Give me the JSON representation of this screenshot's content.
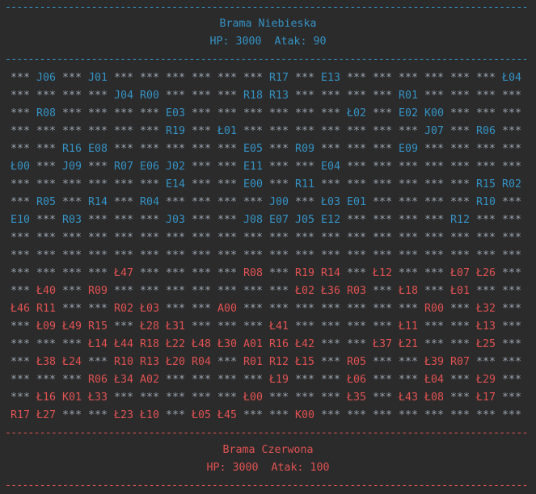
{
  "separator": "-------------------------------------------------------------------------------------------",
  "colors": {
    "blue": "#3592c4",
    "red": "#e05252",
    "empty": "#9aa5b1",
    "background": "#2b2b2b"
  },
  "top_gate": {
    "name": "Brama Niebieska",
    "stats": "HP: 3000  Atak: 90"
  },
  "bottom_gate": {
    "name": "Brama Czerwona",
    "stats": "HP: 3000  Atak: 100"
  },
  "empty_token": "***",
  "board": {
    "blue_rows": 9,
    "rows": [
      [
        "***",
        "J06",
        "***",
        "J01",
        "***",
        "***",
        "***",
        "***",
        "***",
        "***",
        "R17",
        "***",
        "E13",
        "***",
        "***",
        "***",
        "***",
        "***",
        "***",
        "Ł04"
      ],
      [
        "***",
        "***",
        "***",
        "***",
        "J04",
        "R00",
        "***",
        "***",
        "***",
        "R18",
        "R13",
        "***",
        "***",
        "***",
        "***",
        "R01",
        "***",
        "***",
        "***",
        "***"
      ],
      [
        "***",
        "R08",
        "***",
        "***",
        "***",
        "***",
        "E03",
        "***",
        "***",
        "***",
        "***",
        "***",
        "***",
        "Ł02",
        "***",
        "E02",
        "K00",
        "***",
        "***",
        "***"
      ],
      [
        "***",
        "***",
        "***",
        "***",
        "***",
        "***",
        "R19",
        "***",
        "Ł01",
        "***",
        "***",
        "***",
        "***",
        "***",
        "***",
        "***",
        "J07",
        "***",
        "R06",
        "***"
      ],
      [
        "***",
        "***",
        "R16",
        "E08",
        "***",
        "***",
        "***",
        "***",
        "***",
        "E05",
        "***",
        "R09",
        "***",
        "***",
        "***",
        "E09",
        "***",
        "***",
        "***",
        "***"
      ],
      [
        "Ł00",
        "***",
        "J09",
        "***",
        "R07",
        "E06",
        "J02",
        "***",
        "***",
        "E11",
        "***",
        "***",
        "E04",
        "***",
        "***",
        "***",
        "***",
        "***",
        "***",
        "***"
      ],
      [
        "***",
        "***",
        "***",
        "***",
        "***",
        "***",
        "E14",
        "***",
        "***",
        "E00",
        "***",
        "R11",
        "***",
        "***",
        "***",
        "***",
        "***",
        "***",
        "R15",
        "R02"
      ],
      [
        "***",
        "R05",
        "***",
        "R14",
        "***",
        "R04",
        "***",
        "***",
        "***",
        "***",
        "J00",
        "***",
        "Ł03",
        "E01",
        "***",
        "***",
        "***",
        "***",
        "R10",
        "***"
      ],
      [
        "E10",
        "***",
        "R03",
        "***",
        "***",
        "***",
        "J03",
        "***",
        "***",
        "J08",
        "E07",
        "J05",
        "E12",
        "***",
        "***",
        "***",
        "***",
        "R12",
        "***",
        "***"
      ],
      [
        "***",
        "***",
        "***",
        "***",
        "***",
        "***",
        "***",
        "***",
        "***",
        "***",
        "***",
        "***",
        "***",
        "***",
        "***",
        "***",
        "***",
        "***",
        "***",
        "***"
      ],
      [
        "***",
        "***",
        "***",
        "***",
        "***",
        "***",
        "***",
        "***",
        "***",
        "***",
        "***",
        "***",
        "***",
        "***",
        "***",
        "***",
        "***",
        "***",
        "***",
        "***"
      ],
      [
        "***",
        "***",
        "***",
        "***",
        "Ł47",
        "***",
        "***",
        "***",
        "***",
        "R08",
        "***",
        "R19",
        "R14",
        "***",
        "Ł12",
        "***",
        "***",
        "Ł07",
        "Ł26",
        "***"
      ],
      [
        "***",
        "Ł40",
        "***",
        "R09",
        "***",
        "***",
        "***",
        "***",
        "***",
        "***",
        "***",
        "Ł02",
        "Ł36",
        "R03",
        "***",
        "Ł18",
        "***",
        "Ł01",
        "***",
        "***"
      ],
      [
        "Ł46",
        "R11",
        "***",
        "***",
        "R02",
        "Ł03",
        "***",
        "***",
        "A00",
        "***",
        "***",
        "***",
        "***",
        "***",
        "***",
        "***",
        "R00",
        "***",
        "Ł32",
        "***"
      ],
      [
        "***",
        "Ł09",
        "Ł49",
        "R15",
        "***",
        "Ł28",
        "Ł31",
        "***",
        "***",
        "***",
        "Ł41",
        "***",
        "***",
        "***",
        "***",
        "Ł11",
        "***",
        "***",
        "Ł13",
        "***"
      ],
      [
        "***",
        "***",
        "***",
        "Ł14",
        "Ł44",
        "R18",
        "Ł22",
        "Ł48",
        "Ł30",
        "A01",
        "R16",
        "Ł42",
        "***",
        "***",
        "Ł37",
        "Ł21",
        "***",
        "***",
        "Ł25",
        "***"
      ],
      [
        "***",
        "Ł38",
        "Ł24",
        "***",
        "R10",
        "R13",
        "Ł20",
        "R04",
        "***",
        "R01",
        "R12",
        "Ł15",
        "***",
        "R05",
        "***",
        "***",
        "Ł39",
        "R07",
        "***",
        "***"
      ],
      [
        "***",
        "***",
        "***",
        "R06",
        "Ł34",
        "A02",
        "***",
        "***",
        "***",
        "***",
        "Ł19",
        "***",
        "***",
        "Ł06",
        "***",
        "***",
        "Ł04",
        "***",
        "Ł29",
        "***"
      ],
      [
        "***",
        "Ł16",
        "K01",
        "Ł33",
        "***",
        "***",
        "***",
        "***",
        "***",
        "Ł00",
        "***",
        "***",
        "***",
        "Ł35",
        "***",
        "Ł43",
        "Ł08",
        "***",
        "Ł17",
        "***"
      ],
      [
        "R17",
        "Ł27",
        "***",
        "***",
        "Ł23",
        "Ł10",
        "***",
        "Ł05",
        "Ł45",
        "***",
        "***",
        "K00",
        "***",
        "***",
        "***",
        "***",
        "***",
        "***",
        "***",
        "***"
      ]
    ]
  }
}
